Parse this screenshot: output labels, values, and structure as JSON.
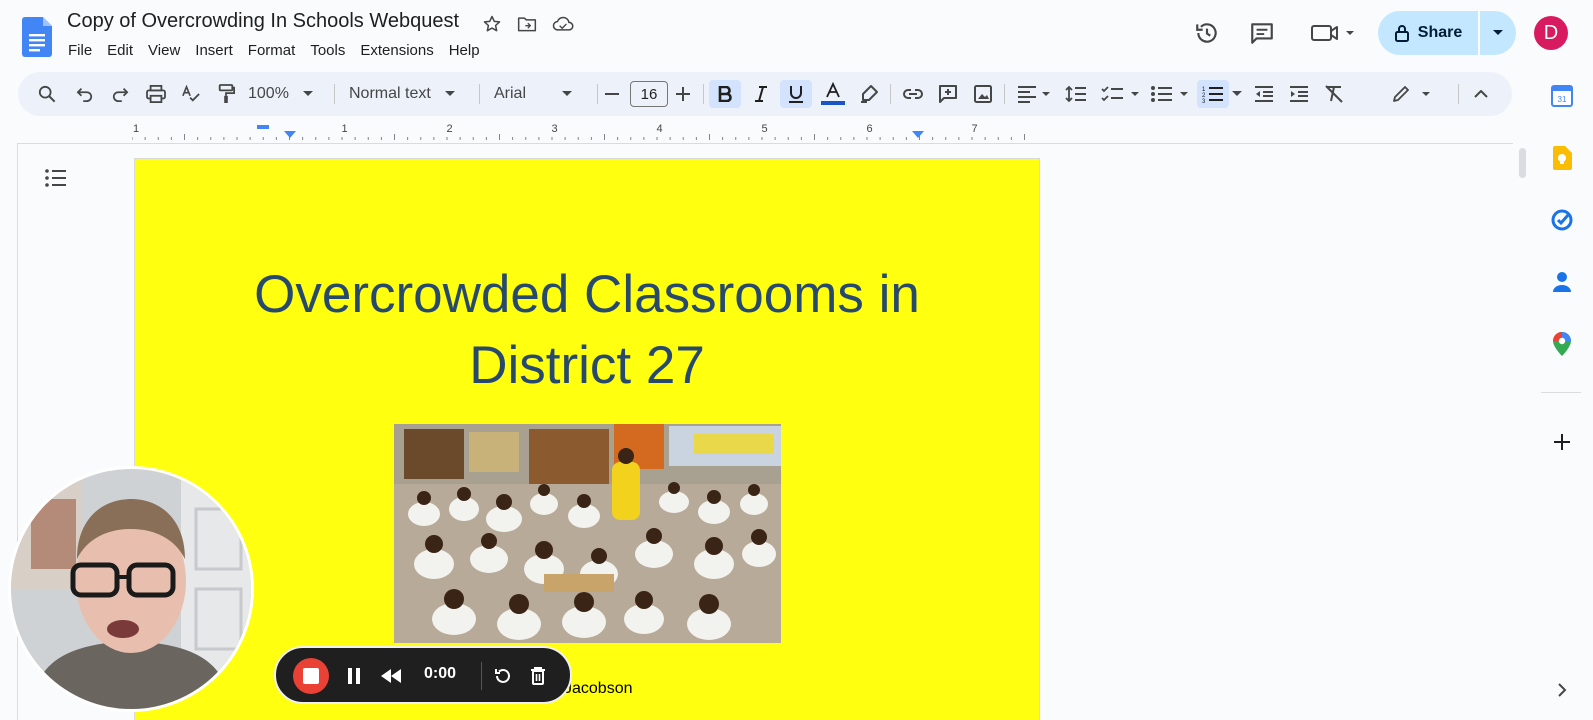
{
  "document": {
    "title": "Copy of Overcrowding In Schools Webquest"
  },
  "menu": [
    "File",
    "Edit",
    "View",
    "Insert",
    "Format",
    "Tools",
    "Extensions",
    "Help"
  ],
  "header": {
    "share_label": "Share",
    "avatar_letter": "D"
  },
  "toolbar": {
    "zoom": "100%",
    "style": "Normal text",
    "font": "Arial",
    "font_size": "16"
  },
  "ruler": {
    "labels": [
      "1",
      "1",
      "2",
      "3",
      "4",
      "5",
      "6",
      "7"
    ]
  },
  "page": {
    "heading_line1": "Overcrowded Classrooms in",
    "heading_line2": "District 27",
    "byline": "Jacobson",
    "background": "#ffff0f",
    "heading_color": "#27496d"
  },
  "recorder": {
    "time": "0:00"
  },
  "colors": {
    "share_bg": "#c2e7ff",
    "avatar_bg": "#d81b60",
    "toolbar_bg": "#edf2fa",
    "record_red": "#e94235"
  }
}
